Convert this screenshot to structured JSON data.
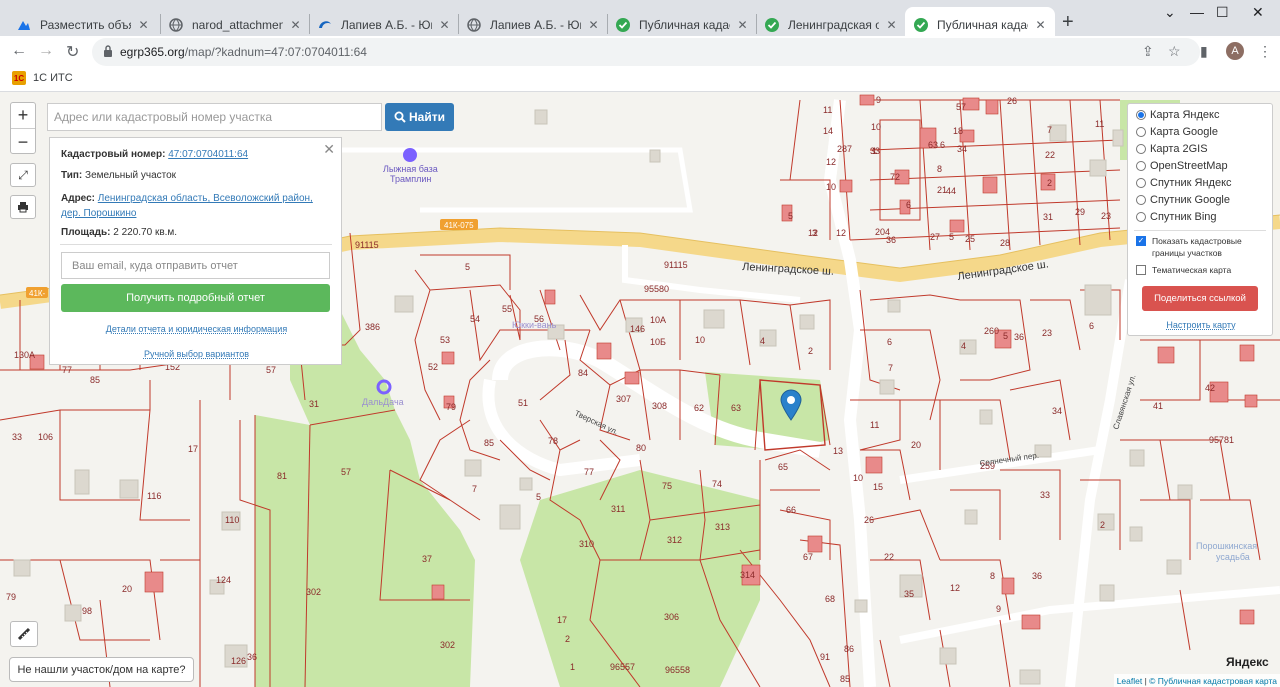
{
  "browser": {
    "tabs": [
      {
        "title": "Разместить объявление",
        "icon": "avito-icon"
      },
      {
        "title": "narod_attachment_links",
        "icon": "globe-icon"
      },
      {
        "title": "Лапиев А.Б. - Юкки - Куз",
        "icon": "edge-icon"
      },
      {
        "title": "Лапиев А.Б. - Юкки - Куз",
        "icon": "globe-icon"
      },
      {
        "title": "Публичная кадастровая",
        "icon": "check-icon"
      },
      {
        "title": "Ленинградская область",
        "icon": "check-icon"
      },
      {
        "title": "Публичная кадастровая",
        "icon": "check-icon",
        "active": true
      }
    ],
    "url_host": "egrp365.org",
    "url_path": "/map/?kadnum=47:07:0704011:64",
    "avatar_letter": "A",
    "bookmark": "1С ИТС",
    "bookmark_icon_text": "1С"
  },
  "map": {
    "search_placeholder": "Адрес или кадастровый номер участка",
    "search_button": "Найти",
    "zoom_in": "+",
    "zoom_out": "−",
    "info": {
      "cadnum_label": "Кадастровый номер:",
      "cadnum_value": "47:07:0704011:64",
      "type_label": "Тип:",
      "type_value": "Земельный участок",
      "address_label": "Адрес:",
      "address_value_1": "Ленинградская область, Всеволожский район,",
      "address_value_2": "дер. Порошкино",
      "area_label": "Площадь:",
      "area_value": "2 220.70 кв.м.",
      "email_placeholder": "Ваш email, куда отправить отчет",
      "report_button": "Получить подробный отчет",
      "details_link": "Детали отчета и юридическая информация",
      "manual_link": "Ручной выбор вариантов"
    },
    "layers": {
      "options": [
        "Карта Яндекс",
        "Карта Google",
        "Карта 2GIS",
        "OpenStreetMap",
        "Спутник Яндекс",
        "Спутник Google",
        "Спутник Bing"
      ],
      "selected": "Карта Яндекс",
      "show_cadastral_line1": "Показать кадастровые",
      "show_cadastral_line2": "границы участков",
      "thematic": "Тематическая карта",
      "share_button": "Поделиться ссылкой",
      "configure_link": "Настроить карту"
    },
    "not_found_button": "Не нашли участок/дом на карте?",
    "attribution_leaflet": "Leaflet",
    "attribution_pkk": "© Публичная кадастровая карта",
    "labels": {
      "road_main": "Ленинградское ш.",
      "road_main2": "Ленинградское ш.",
      "road_code": "41К-075",
      "road_code2": "41К-",
      "ski_base_1": "Лыжная база",
      "ski_base_2": "Трамплин",
      "yukki": "Юкки-вань",
      "solnechny": "Солнечный пер.",
      "tverskaya": "Тверская ул.",
      "slavyanskaya": "Славянская ул.",
      "dalnyaya": "ДальДача",
      "poroshkinsk_1": "Порошкинская",
      "poroshkinsk_2": "усадьба",
      "yandex": "Яндекс"
    },
    "parcel_numbers": [
      "5",
      "91115",
      "95580",
      "91115",
      "54",
      "55",
      "56",
      "53",
      "52",
      "79",
      "51",
      "85",
      "78",
      "84",
      "18",
      "307",
      "308",
      "62",
      "63",
      "64",
      "146",
      "10А",
      "10Б",
      "10",
      "4",
      "2",
      "80",
      "77",
      "7",
      "5",
      "65",
      "66",
      "75",
      "74",
      "311",
      "310",
      "312",
      "313",
      "306",
      "67",
      "68",
      "314",
      "57",
      "37",
      "302",
      "302",
      "31",
      "81",
      "110",
      "116",
      "33",
      "106",
      "17",
      "124",
      "20",
      "98",
      "79",
      "126",
      "36",
      "557",
      "2",
      "17",
      "96557",
      "96558",
      "91",
      "8",
      "85",
      "86",
      "11",
      "20",
      "10",
      "15",
      "6",
      "7",
      "13",
      "3",
      "26",
      "22",
      "35",
      "12",
      "8",
      "36",
      "9",
      "33",
      "2",
      "34",
      "95781",
      "259",
      "41",
      "42",
      "4",
      "5",
      "23",
      "260",
      "36",
      "6",
      "130А",
      "77",
      "85",
      "152",
      "386",
      "57",
      "11",
      "14",
      "12",
      "10",
      "3",
      "9",
      "287",
      "1",
      "33",
      "72",
      "63",
      "6",
      "8",
      "21",
      "34",
      "44",
      "22",
      "31",
      "29",
      "23",
      "7",
      "11",
      "5",
      "12",
      "204",
      "36",
      "5",
      "27",
      "25",
      "28"
    ]
  }
}
